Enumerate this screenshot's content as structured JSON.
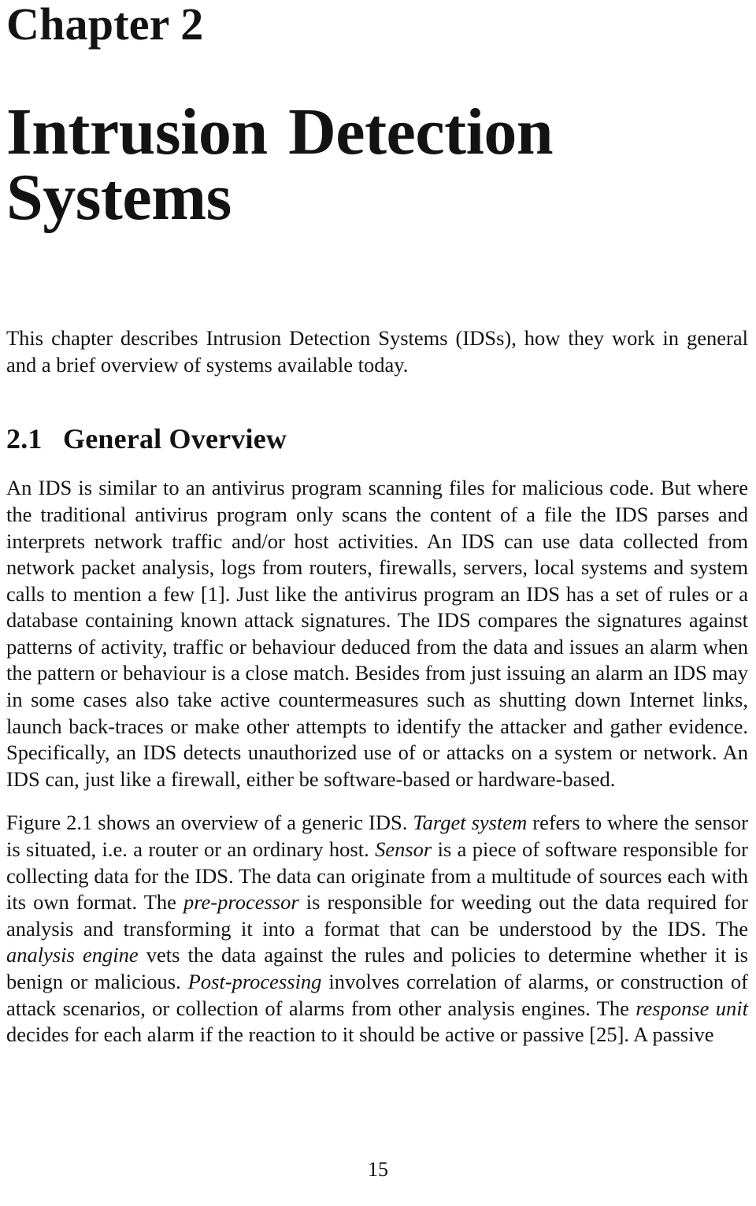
{
  "document": {
    "chapter_label": "Chapter 2",
    "chapter_title": "Intrusion Detection Systems",
    "intro_paragraph": "This chapter describes Intrusion Detection Systems (IDSs), how they work in general and a brief overview of systems available today.",
    "section": {
      "number": "2.1",
      "title": "General Overview"
    },
    "paragraph_1": "An IDS is similar to an antivirus program scanning files for malicious code. But where the traditional antivirus program only scans the content of a file the IDS parses and interprets network traffic and/or host activities. An IDS can use data collected from network packet analysis, logs from routers, firewalls, servers, local systems and system calls to mention a few [1]. Just like the antivirus program an IDS has a set of rules or a database containing known attack signatures. The IDS compares the signatures against patterns of activity, traffic or behaviour deduced from the data and issues an alarm when the pattern or behaviour is a close match. Besides from just issuing an alarm an IDS may in some cases also take active countermeasures such as shutting down Internet links, launch back-traces or make other attempts to identify the attacker and gather evidence. Specifically, an IDS detects unauthorized use of or attacks on a system or network. An IDS can, just like a firewall, either be software-based or hardware-based.",
    "paragraph_2_segments": [
      {
        "text": "Figure 2.1 shows an overview of a generic IDS. ",
        "italic": false
      },
      {
        "text": "Target system",
        "italic": true
      },
      {
        "text": " refers to where the sensor is situated, i.e. a router or an ordinary host. ",
        "italic": false
      },
      {
        "text": "Sensor",
        "italic": true
      },
      {
        "text": " is a piece of software responsible for collecting data for the IDS. The data can originate from a multitude of sources each with its own format. The ",
        "italic": false
      },
      {
        "text": "pre-processor",
        "italic": true
      },
      {
        "text": " is responsible for weeding out the data required for analysis and transforming it into a format that can be understood by the IDS. The ",
        "italic": false
      },
      {
        "text": "analysis engine",
        "italic": true
      },
      {
        "text": " vets the data against the rules and policies to determine whether it is benign or malicious. ",
        "italic": false
      },
      {
        "text": "Post-processing",
        "italic": true
      },
      {
        "text": " involves correlation of alarms, or construction of attack scenarios, or collection of alarms from other analysis engines. The ",
        "italic": false
      },
      {
        "text": "response unit",
        "italic": true
      },
      {
        "text": " decides for each alarm if the reaction to it should be active or passive [25]. A passive",
        "italic": false
      }
    ],
    "page_number": "15",
    "colors": {
      "page_background": "#ffffff",
      "text": "#131313"
    }
  }
}
